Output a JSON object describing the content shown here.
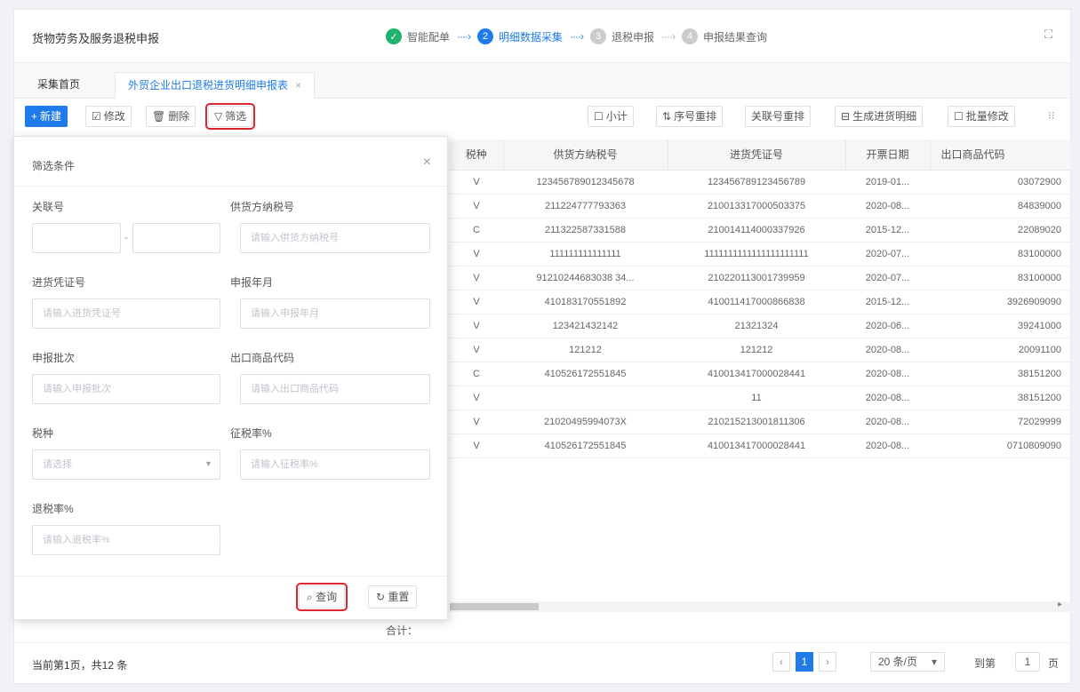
{
  "app": {
    "title": "货物劳务及服务退税申报",
    "expand_icon": "⛶"
  },
  "steps": [
    {
      "num": "✓",
      "label": "智能配单",
      "state": "done"
    },
    {
      "num": "2",
      "label": "明细数据采集",
      "state": "active"
    },
    {
      "num": "3",
      "label": "退税申报",
      "state": "pending"
    },
    {
      "num": "4",
      "label": "申报结果查询",
      "state": "pending"
    }
  ],
  "step_arrow": "····›",
  "tabs": [
    {
      "label": "采集首页"
    },
    {
      "label": "外贸企业出口退税进货明细申报表",
      "close": "×"
    }
  ],
  "toolbar": {
    "add": "新建",
    "edit": "修改",
    "delete": "删除",
    "filter": "筛选",
    "subtotal": "小计",
    "seq_sort": "序号重排",
    "link_sort": "关联号重排",
    "gen_detail": "生成进货明细",
    "batch_edit": "批量修改",
    "add_icon": "+",
    "edit_icon": "☑",
    "delete_icon": "🗑",
    "filter_icon": "▽",
    "subtotal_icon": "☐",
    "seq_icon": "⇅",
    "gen_icon": "⊟",
    "batch_icon": "☐",
    "more_icon": "⁝⁝"
  },
  "table": {
    "columns": [
      "税种",
      "供货方纳税号",
      "进货凭证号",
      "开票日期",
      "出口商品代码"
    ],
    "rows": [
      [
        "V",
        "123456789012345678",
        "123456789123456789",
        "2019-01...",
        "03072900"
      ],
      [
        "V",
        "211224777793363",
        "210013317000503375",
        "2020-08...",
        "84839000"
      ],
      [
        "C",
        "211322587331588",
        "210014114000337926",
        "2015-12...",
        "22089020"
      ],
      [
        "V",
        "111111111111111",
        "1111111111111111111111",
        "2020-07...",
        "83100000"
      ],
      [
        "V",
        "91210244683038 34...",
        "210220113001739959",
        "2020-07...",
        "83100000"
      ],
      [
        "V",
        "410183170551892",
        "410011417000866838",
        "2015-12...",
        "3926909090"
      ],
      [
        "V",
        "123421432142",
        "21321324",
        "2020-06...",
        "39241000"
      ],
      [
        "V",
        "121212",
        "121212",
        "2020-08...",
        "20091100"
      ],
      [
        "C",
        "410526172551845",
        "410013417000028441",
        "2020-08...",
        "38151200"
      ],
      [
        "V",
        "",
        "11",
        "2020-08...",
        "38151200"
      ],
      [
        "V",
        "21020495994073X",
        "210215213001811306",
        "2020-08...",
        "72029999"
      ],
      [
        "V",
        "410526172551845",
        "410013417000028441",
        "2020-08...",
        "0710809090"
      ]
    ]
  },
  "total_label": "合计：",
  "footer": {
    "count": "当前第1页，共12 条",
    "prev": "‹",
    "page": "1",
    "next": "›",
    "page_size": "20 条/页",
    "goto_label": "到第",
    "goto_value": "1",
    "page_suffix": "页",
    "size_arrow": "▾"
  },
  "filter_panel": {
    "title": "筛选条件",
    "close": "×",
    "fields": {
      "link_no": {
        "label": "关联号"
      },
      "supplier_tax": {
        "label": "供货方纳税号",
        "placeholder": "请输入供货方纳税号"
      },
      "voucher_no": {
        "label": "进货凭证号",
        "placeholder": "请输入进货凭证号"
      },
      "period": {
        "label": "申报年月",
        "placeholder": "请输入申报年月"
      },
      "batch": {
        "label": "申报批次",
        "placeholder": "请输入申报批次"
      },
      "goods_code": {
        "label": "出口商品代码",
        "placeholder": "请输入出口商品代码"
      },
      "tax_type": {
        "label": "税种",
        "placeholder": "请选择"
      },
      "levy_rate": {
        "label": "征税率%",
        "placeholder": "请输入征税率%"
      },
      "refund_rate": {
        "label": "退税率%",
        "placeholder": "请输入退税率%"
      }
    },
    "range_sep": "-",
    "query": "查询",
    "reset": "重置",
    "query_icon": "⌕",
    "reset_icon": "↻"
  }
}
